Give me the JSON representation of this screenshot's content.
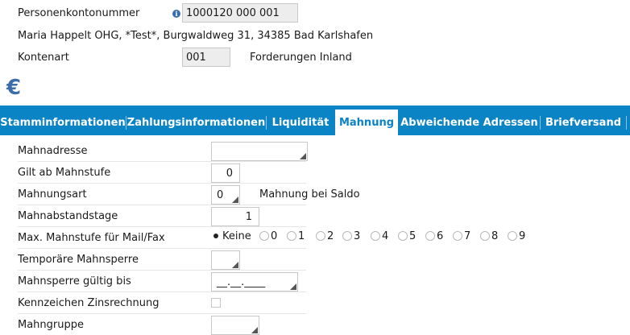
{
  "header": {
    "account_label": "Personenkontonummer",
    "account_value": "1000120 000 001",
    "address": "Maria Happelt OHG, *Test*, Burgwaldweg 31, 34385 Bad Karlshafen",
    "kontenart_label": "Kontenart",
    "kontenart_value": "001",
    "kontenart_text": "Forderungen Inland",
    "info_icon": "info-icon",
    "currency_icon": "euro-icon",
    "accent_color": "#3a6ea8"
  },
  "tabs": [
    {
      "label": "Stamminformationen"
    },
    {
      "label": "Zahlungsinformationen"
    },
    {
      "label": "Liquidität"
    },
    {
      "label": "Mahnung",
      "active": true
    },
    {
      "label": "Abweichende Adressen"
    },
    {
      "label": "Briefversand"
    }
  ],
  "tab_bar_color": "#0b84c6",
  "form": {
    "mahnadresse": {
      "label": "Mahnadresse",
      "value": ""
    },
    "gilt_ab": {
      "label": "Gilt ab Mahnstufe",
      "value": "0"
    },
    "mahnungsart": {
      "label": "Mahnungsart",
      "value": "0",
      "text": "Mahnung bei Saldo"
    },
    "abstandstage": {
      "label": "Mahnabstandstage",
      "value": "1"
    },
    "max_mahnstufe": {
      "label": "Max. Mahnstufe für Mail/Fax",
      "options": [
        "Keine",
        "0",
        "1",
        "2",
        "3",
        "4",
        "5",
        "6",
        "7",
        "8",
        "9"
      ],
      "selected": "Keine"
    },
    "temp_sperre": {
      "label": "Temporäre Mahnsperre",
      "value": ""
    },
    "sperre_bis": {
      "label": "Mahnsperre gültig bis",
      "value": "__.__.____"
    },
    "zinsrechnung": {
      "label": "Kennzeichen Zinsrechnung",
      "checked": false
    },
    "mahngruppe": {
      "label": "Mahngruppe",
      "value": ""
    }
  }
}
